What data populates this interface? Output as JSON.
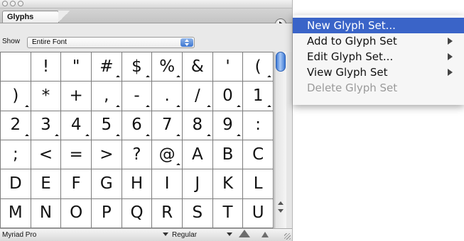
{
  "panel": {
    "tab_label": "Glyphs",
    "show_label": "Show",
    "show_value": "Entire Font",
    "font_name": "Myriad Pro",
    "font_style": "Regular"
  },
  "glyph_rows": [
    [
      {
        "g": "",
        "alt": false
      },
      {
        "g": "!",
        "alt": false
      },
      {
        "g": "\"",
        "alt": false
      },
      {
        "g": "#",
        "alt": true
      },
      {
        "g": "$",
        "alt": true
      },
      {
        "g": "%",
        "alt": true
      },
      {
        "g": "&",
        "alt": false
      },
      {
        "g": "'",
        "alt": false
      },
      {
        "g": "(",
        "alt": true
      }
    ],
    [
      {
        "g": ")",
        "alt": true
      },
      {
        "g": "*",
        "alt": false
      },
      {
        "g": "+",
        "alt": false
      },
      {
        "g": ",",
        "alt": true
      },
      {
        "g": "-",
        "alt": true
      },
      {
        "g": ".",
        "alt": true
      },
      {
        "g": "/",
        "alt": true
      },
      {
        "g": "0",
        "alt": true
      },
      {
        "g": "1",
        "alt": true
      }
    ],
    [
      {
        "g": "2",
        "alt": true
      },
      {
        "g": "3",
        "alt": true
      },
      {
        "g": "4",
        "alt": true
      },
      {
        "g": "5",
        "alt": true
      },
      {
        "g": "6",
        "alt": true
      },
      {
        "g": "7",
        "alt": true
      },
      {
        "g": "8",
        "alt": true
      },
      {
        "g": "9",
        "alt": true
      },
      {
        "g": ":",
        "alt": false
      }
    ],
    [
      {
        "g": ";",
        "alt": false
      },
      {
        "g": "<",
        "alt": false
      },
      {
        "g": "=",
        "alt": false
      },
      {
        "g": ">",
        "alt": false
      },
      {
        "g": "?",
        "alt": false
      },
      {
        "g": "@",
        "alt": true
      },
      {
        "g": "A",
        "alt": false
      },
      {
        "g": "B",
        "alt": false
      },
      {
        "g": "C",
        "alt": false
      }
    ],
    [
      {
        "g": "D",
        "alt": false
      },
      {
        "g": "E",
        "alt": false
      },
      {
        "g": "F",
        "alt": false
      },
      {
        "g": "G",
        "alt": false
      },
      {
        "g": "H",
        "alt": false
      },
      {
        "g": "I",
        "alt": false
      },
      {
        "g": "J",
        "alt": false
      },
      {
        "g": "K",
        "alt": false
      },
      {
        "g": "L",
        "alt": false
      }
    ],
    [
      {
        "g": "M",
        "alt": false
      },
      {
        "g": "N",
        "alt": false
      },
      {
        "g": "O",
        "alt": false
      },
      {
        "g": "P",
        "alt": false
      },
      {
        "g": "Q",
        "alt": false
      },
      {
        "g": "R",
        "alt": false
      },
      {
        "g": "S",
        "alt": false
      },
      {
        "g": "T",
        "alt": false
      },
      {
        "g": "U",
        "alt": false
      }
    ]
  ],
  "menu": {
    "items": [
      {
        "label": "New Glyph Set...",
        "highlighted": true,
        "submenu": false,
        "disabled": false
      },
      {
        "label": "Add to Glyph Set",
        "highlighted": false,
        "submenu": true,
        "disabled": false
      },
      {
        "label": "Edit Glyph Set...",
        "highlighted": false,
        "submenu": true,
        "disabled": false
      },
      {
        "label": "View Glyph Set",
        "highlighted": false,
        "submenu": true,
        "disabled": false
      },
      {
        "label": "Delete Glyph Set",
        "highlighted": false,
        "submenu": false,
        "disabled": true
      }
    ]
  },
  "icons": {
    "panel_menu": "panel-menu-icon",
    "show_dropdown": "up-down-arrows-icon",
    "zoom_out": "zoom-out-icon",
    "zoom_in": "zoom-in-icon",
    "resize": "resize-grip-icon",
    "submenu": "submenu-arrow-icon"
  },
  "colors": {
    "highlight": "#3a64c8",
    "scroll_thumb": "#3e79d5"
  }
}
